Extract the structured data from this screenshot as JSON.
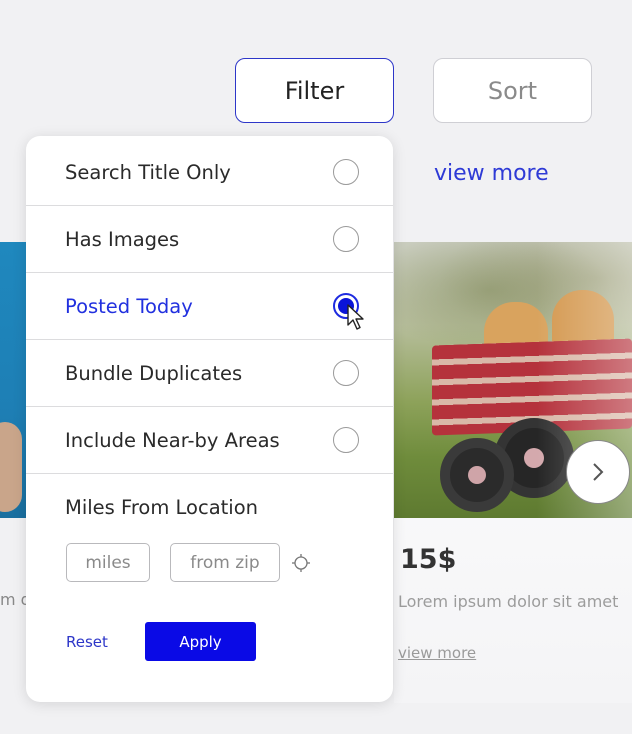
{
  "toolbar": {
    "filter_label": "Filter",
    "sort_label": "Sort"
  },
  "view_more_top": "view more",
  "filter_panel": {
    "options": [
      {
        "label": "Search Title Only",
        "checked": false
      },
      {
        "label": "Has Images",
        "checked": false
      },
      {
        "label": "Posted Today",
        "checked": true
      },
      {
        "label": "Bundle Duplicates",
        "checked": false
      },
      {
        "label": "Include Near-by Areas",
        "checked": false
      }
    ],
    "miles_section_label": "Miles From Location",
    "miles_placeholder": "miles",
    "zip_placeholder": "from zip",
    "reset_label": "Reset",
    "apply_label": "Apply"
  },
  "listing_right": {
    "price": "15$",
    "description": "Lorem ipsum dolor sit amet",
    "link": "view more"
  },
  "listing_left": {
    "description": "m d"
  },
  "colors": {
    "accent": "#0a0ae6",
    "active_text": "#2130df",
    "background": "#f1f1f3"
  }
}
